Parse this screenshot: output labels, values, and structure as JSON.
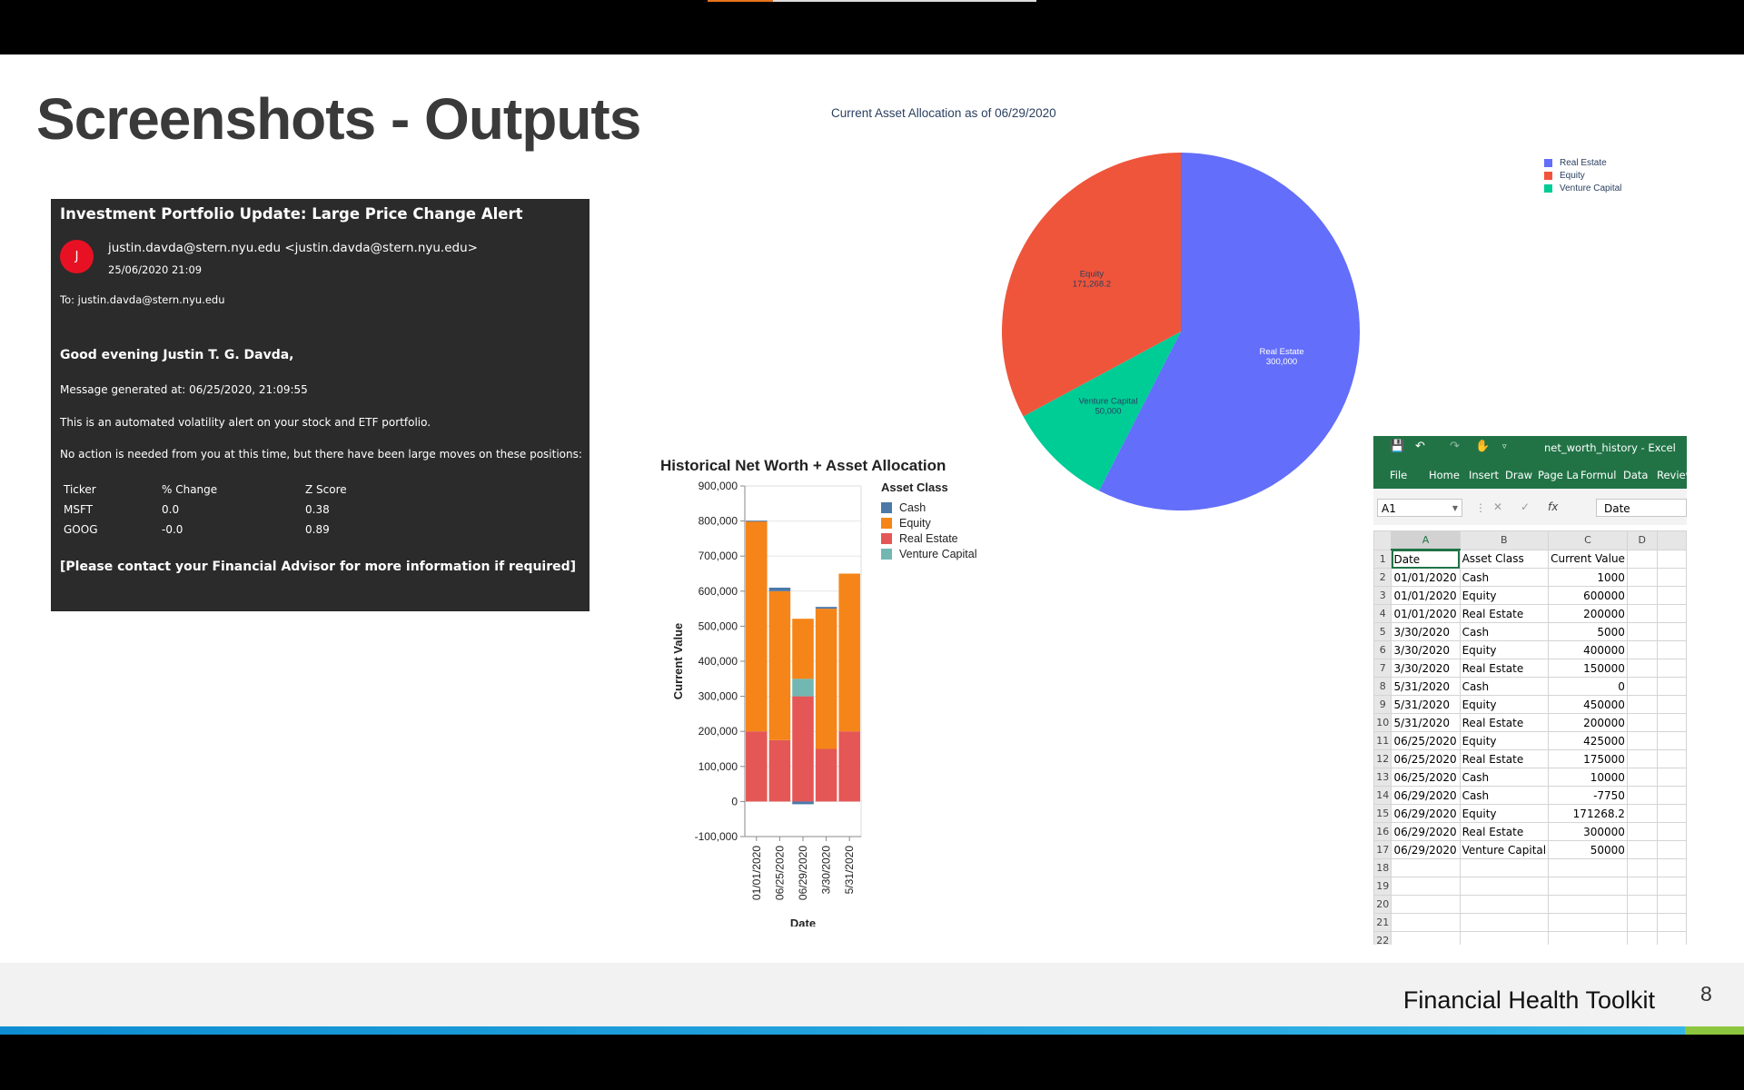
{
  "slide": {
    "title": "Screenshots - Outputs",
    "footer_title": "Financial Health Toolkit",
    "page_number": "8"
  },
  "email": {
    "subject": "Investment Portfolio Update: Large Price Change Alert",
    "avatar_initial": "J",
    "sender": "justin.davda@stern.nyu.edu <justin.davda@stern.nyu.edu>",
    "sent": "25/06/2020 21:09",
    "to": "To: justin.davda@stern.nyu.edu",
    "greeting": "Good evening Justin T. G. Davda,",
    "generated": "Message generated at: 06/25/2020, 21:09:55",
    "alert_line": "This is an automated volatility alert on your stock and ETF portfolio.",
    "no_action": "No action is needed from you at this time, but there have been large moves on these positions:",
    "table_headers": [
      "Ticker",
      "% Change",
      "Z Score"
    ],
    "table_rows": [
      [
        "MSFT",
        "0.0",
        "0.38"
      ],
      [
        "GOOG",
        "-0.0",
        "0.89"
      ]
    ],
    "footer": "[Please contact your Financial Advisor for more information if required]"
  },
  "pie_chart": {
    "title": "Current Asset Allocation as of 06/29/2020",
    "legend": [
      "Real Estate",
      "Equity",
      "Venture Capital"
    ],
    "slice_labels": [
      [
        "Real Estate",
        "300,000"
      ],
      [
        "Equity",
        "171,268.2"
      ],
      [
        "Venture Capital",
        "50,000"
      ]
    ]
  },
  "bar_chart": {
    "title": "Historical Net Worth + Asset Allocation",
    "xlabel": "Date",
    "ylabel": "Current Value",
    "legend_title": "Asset Class",
    "legend": [
      "Cash",
      "Equity",
      "Real Estate",
      "Venture Capital"
    ]
  },
  "colors": {
    "pie_real_estate": "#636efa",
    "pie_equity": "#ef553b",
    "pie_venture": "#00cc96",
    "cash": "#4c78a8",
    "equity": "#f58518",
    "real_estate": "#e45756",
    "venture": "#72b7b2",
    "excel_green": "#217346"
  },
  "chart_data": [
    {
      "type": "pie",
      "title": "Current Asset Allocation as of 06/29/2020",
      "categories": [
        "Real Estate",
        "Equity",
        "Venture Capital"
      ],
      "values": [
        300000,
        171268.2,
        50000
      ],
      "legend_position": "top-right"
    },
    {
      "type": "bar",
      "stacked": true,
      "title": "Historical Net Worth + Asset Allocation",
      "xlabel": "Date",
      "ylabel": "Current Value",
      "categories": [
        "01/01/2020",
        "06/25/2020",
        "06/29/2020",
        "3/30/2020",
        "5/31/2020"
      ],
      "series": [
        {
          "name": "Cash",
          "values": [
            1000,
            10000,
            -7750,
            5000,
            0
          ]
        },
        {
          "name": "Equity",
          "values": [
            600000,
            425000,
            171268.2,
            400000,
            450000
          ]
        },
        {
          "name": "Real Estate",
          "values": [
            200000,
            175000,
            300000,
            150000,
            200000
          ]
        },
        {
          "name": "Venture Capital",
          "values": [
            0,
            0,
            50000,
            0,
            0
          ]
        }
      ],
      "ylim": [
        -100000,
        900000
      ],
      "yticks": [
        "900,000",
        "800,000",
        "700,000",
        "600,000",
        "500,000",
        "400,000",
        "300,000",
        "200,000",
        "100,000",
        "0",
        "-100,000"
      ],
      "legend_position": "right"
    }
  ],
  "excel": {
    "title": "net_worth_history  -  Excel",
    "ribbon": [
      "File",
      "Home",
      "Insert",
      "Draw",
      "Page La",
      "Formul",
      "Data",
      "Review"
    ],
    "name_box": "A1",
    "formula_value": "Date",
    "columns": [
      "A",
      "B",
      "C",
      "D"
    ],
    "rows": [
      [
        "Date",
        "Asset Class",
        "Current Value",
        ""
      ],
      [
        "01/01/2020",
        "Cash",
        "1000",
        ""
      ],
      [
        "01/01/2020",
        "Equity",
        "600000",
        ""
      ],
      [
        "01/01/2020",
        "Real Estate",
        "200000",
        ""
      ],
      [
        "3/30/2020",
        "Cash",
        "5000",
        ""
      ],
      [
        "3/30/2020",
        "Equity",
        "400000",
        ""
      ],
      [
        "3/30/2020",
        "Real Estate",
        "150000",
        ""
      ],
      [
        "5/31/2020",
        "Cash",
        "0",
        ""
      ],
      [
        "5/31/2020",
        "Equity",
        "450000",
        ""
      ],
      [
        "5/31/2020",
        "Real Estate",
        "200000",
        ""
      ],
      [
        "06/25/2020",
        "Equity",
        "425000",
        ""
      ],
      [
        "06/25/2020",
        "Real Estate",
        "175000",
        ""
      ],
      [
        "06/25/2020",
        "Cash",
        "10000",
        ""
      ],
      [
        "06/29/2020",
        "Cash",
        "-7750",
        ""
      ],
      [
        "06/29/2020",
        "Equity",
        "171268.2",
        ""
      ],
      [
        "06/29/2020",
        "Real Estate",
        "300000",
        ""
      ],
      [
        "06/29/2020",
        "Venture Capital",
        "50000",
        ""
      ],
      [
        "",
        "",
        "",
        ""
      ],
      [
        "",
        "",
        "",
        ""
      ],
      [
        "",
        "",
        "",
        ""
      ],
      [
        "",
        "",
        "",
        ""
      ],
      [
        "",
        "",
        "",
        ""
      ]
    ]
  }
}
